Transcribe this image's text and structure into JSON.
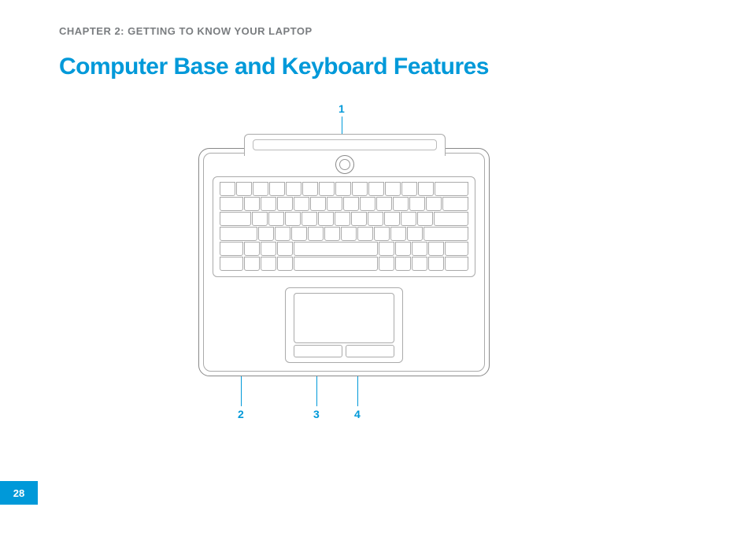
{
  "chapter_label": "CHAPTER 2: GETTING TO KNOW YOUR LAPTOP",
  "page_title": "Computer Base and Keyboard Features",
  "callouts": {
    "c1": "1",
    "c2": "2",
    "c3": "3",
    "c4": "4"
  },
  "page_number": "28"
}
